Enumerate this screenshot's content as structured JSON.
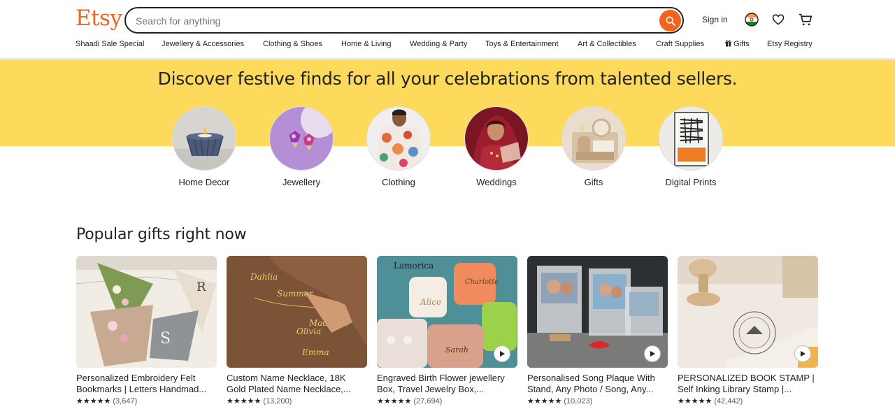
{
  "header": {
    "logo": "Etsy",
    "search_placeholder": "Search for anything",
    "signin": "Sign in"
  },
  "nav": [
    {
      "label": "Shaadi Sale Special"
    },
    {
      "label": "Jewellery & Accessories"
    },
    {
      "label": "Clothing & Shoes"
    },
    {
      "label": "Home & Living"
    },
    {
      "label": "Wedding & Party"
    },
    {
      "label": "Toys & Entertainment"
    },
    {
      "label": "Art & Collectibles"
    },
    {
      "label": "Craft Supplies"
    },
    {
      "label": "Gifts"
    },
    {
      "label": "Etsy Registry"
    }
  ],
  "banner": {
    "headline": "Discover festive finds for all your celebrations from talented sellers."
  },
  "categories": [
    {
      "label": "Home Decor"
    },
    {
      "label": "Jewellery"
    },
    {
      "label": "Clothing"
    },
    {
      "label": "Weddings"
    },
    {
      "label": "Gifts"
    },
    {
      "label": "Digital Prints"
    }
  ],
  "popular": {
    "title": "Popular gifts right now",
    "items": [
      {
        "line1": "Personalized Embroidery Felt",
        "line2": "Bookmarks | Letters Handmad...",
        "stars": "★★★★★",
        "count": "(3,647)",
        "video": false
      },
      {
        "line1": "Custom Name Necklace, 18K",
        "line2": "Gold Plated Name Necklace,...",
        "stars": "★★★★★",
        "count": "(13,200)",
        "video": false
      },
      {
        "line1": "Engraved Birth Flower jewellery",
        "line2": "Box, Travel Jewelry Box,...",
        "stars": "★★★★★",
        "count": "(27,694)",
        "video": true
      },
      {
        "line1": "Personalised Song Plaque With",
        "line2": "Stand, Any Photo / Song, Any...",
        "stars": "★★★★★",
        "count": "(10,023)",
        "video": true
      },
      {
        "line1": "PERSONALIZED BOOK STAMP |",
        "line2": "Self Inking Library Stamp |...",
        "stars": "★★★★★",
        "count": "(42,442)",
        "video": true
      }
    ]
  },
  "colors": {
    "brand": "#f1641e",
    "banner": "#fdd95c"
  }
}
